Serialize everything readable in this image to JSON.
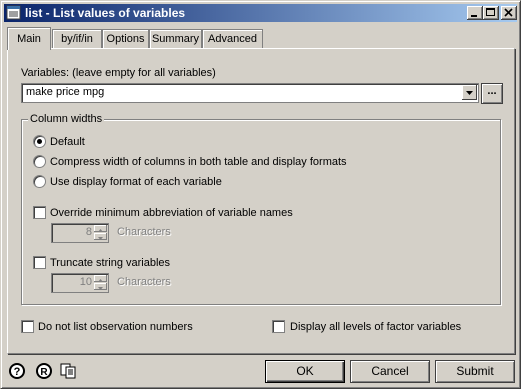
{
  "window": {
    "title": "list - List values of variables"
  },
  "tabs": [
    {
      "label": "Main"
    },
    {
      "label": "by/if/in"
    },
    {
      "label": "Options"
    },
    {
      "label": "Summary"
    },
    {
      "label": "Advanced"
    }
  ],
  "variables": {
    "label": "Variables: (leave empty for all variables)",
    "value": "make price mpg",
    "browse_label": "..."
  },
  "column_widths": {
    "title": "Column widths",
    "options": [
      {
        "label": "Default",
        "selected": true
      },
      {
        "label": "Compress width of columns in both table and display formats",
        "selected": false
      },
      {
        "label": "Use display format of each variable",
        "selected": false
      }
    ],
    "override": {
      "label": "Override minimum abbreviation of variable names",
      "checked": false,
      "value": "8",
      "unit": "Characters"
    },
    "truncate": {
      "label": "Truncate string variables",
      "checked": false,
      "value": "10",
      "unit": "Characters"
    }
  },
  "bottom_options": {
    "no_obs_numbers": {
      "label": "Do not list observation numbers",
      "checked": false
    },
    "factor_levels": {
      "label": "Display all levels of factor variables",
      "checked": false
    }
  },
  "buttons": {
    "ok": "OK",
    "cancel": "Cancel",
    "submit": "Submit"
  },
  "icons": [
    "list-app-icon",
    "minimize-icon",
    "maximize-icon",
    "close-icon",
    "help-icon",
    "reset-icon",
    "copy-icon",
    "dropdown-arrow-icon",
    "spin-up-icon",
    "spin-down-icon"
  ]
}
